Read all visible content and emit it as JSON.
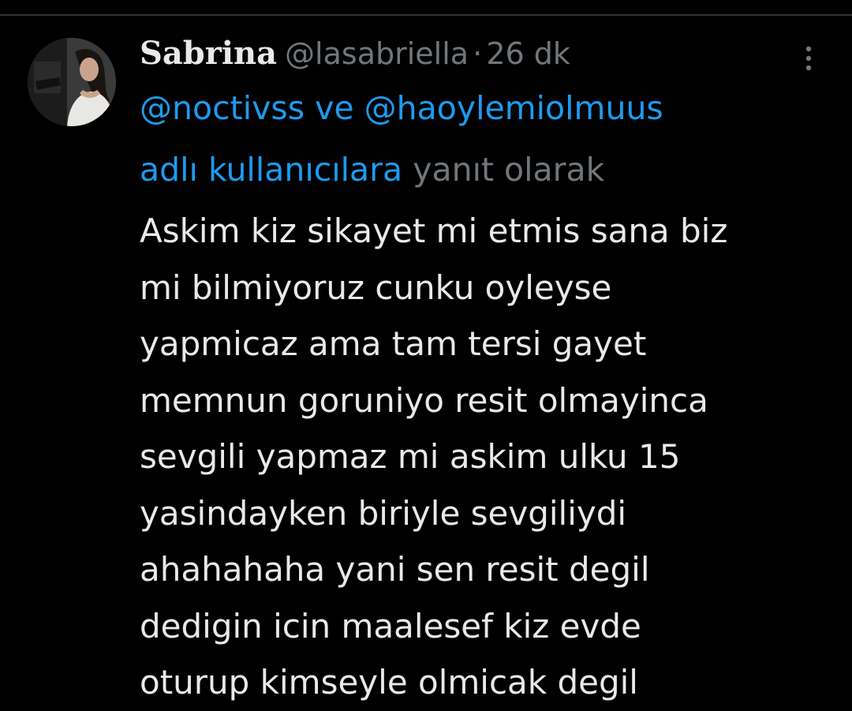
{
  "tweet": {
    "author": {
      "display_name": "Sabrina",
      "handle": "@lasabriella",
      "time_separator": "·",
      "timestamp": "26 dk"
    },
    "reply_to": {
      "mention_1": "@noctivss",
      "connector": " ve ",
      "mention_2": "@haoylemiolmuus",
      "suffix_linked": "adlı kullanıcılara",
      "suffix_plain": " yanıt olarak"
    },
    "text_lines": [
      "Askim kiz sikayet mi etmis sana biz",
      "mi bilmiyoruz cunku oyleyse",
      "yapmicaz ama tam tersi gayet",
      "memnun goruniyo resit olmayinca",
      "sevgili yapmaz mi askim ulku 15",
      "yasindayken biriyle sevgiliydi",
      "ahahahaha yani sen resit degil",
      "dedigin icin maalesef kiz evde",
      "oturup kimseyle olmicak degil"
    ],
    "icons": {
      "more": "more-vertical-icon",
      "avatar": "profile-photo"
    }
  },
  "colors": {
    "background": "#000000",
    "text": "#e7e9ea",
    "muted": "#71767b",
    "link": "#1d9bf0"
  }
}
